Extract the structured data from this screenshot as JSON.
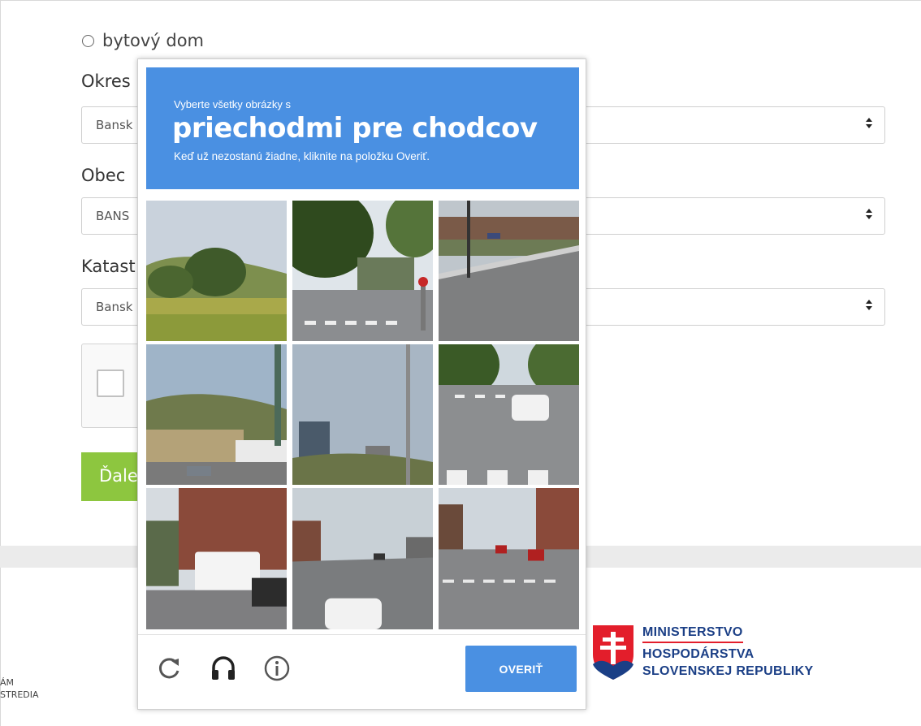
{
  "form": {
    "radio_label": "bytový dom",
    "okres_label": "Okres",
    "okres_value": "Bansk",
    "obec_label": "Obec",
    "obec_value": "BANS",
    "kataster_label": "Katast",
    "kataster_value": "Bansk",
    "next_label": "Ďale"
  },
  "captcha": {
    "instruction_small": "Vyberte všetky obrázky s",
    "instruction_target": "priechodmi pre chodcov",
    "instruction_sub": "Keď už nezostanú žiadne, kliknite na položku Overiť.",
    "verify_label": "OVERIŤ",
    "header_color": "#4a90e2",
    "controls": [
      "reload-icon",
      "audio-headphones-icon",
      "info-icon"
    ],
    "tiles": [
      "hillside-trees",
      "crosswalk-intersection",
      "street-parking-lot",
      "hill-buildings-pole",
      "buildings-pole-sky",
      "street-car-crosswalk",
      "street-bus-brick-building",
      "avenue-traffic",
      "street-crosswalk-cars"
    ]
  },
  "footer": {
    "partial_line1": "ÁM",
    "partial_line2": "STREDIA",
    "ministry_line1": "MINISTERSTVO",
    "ministry_line2": "HOSPODÁRSTVA",
    "ministry_line3": "SLOVENSKEJ REPUBLIKY",
    "brand_red": "#e31e2b",
    "brand_blue": "#1b3f86"
  },
  "colors": {
    "next_button": "#8dc63f"
  }
}
